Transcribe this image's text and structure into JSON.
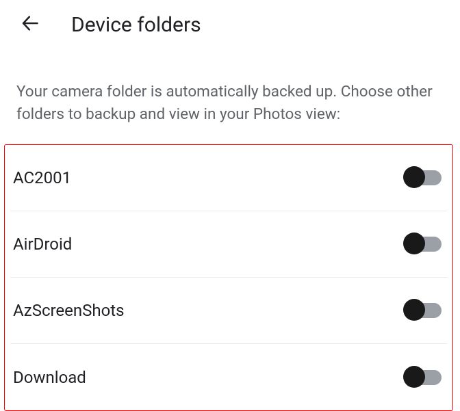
{
  "header": {
    "title": "Device folders"
  },
  "description": "Your camera folder is automatically backed up. Choose other folders to backup and view in your Photos view:",
  "folders": [
    {
      "label": "AC2001",
      "on": false
    },
    {
      "label": "AirDroid",
      "on": false
    },
    {
      "label": "AzScreenShots",
      "on": false
    },
    {
      "label": "Download",
      "on": false
    }
  ]
}
